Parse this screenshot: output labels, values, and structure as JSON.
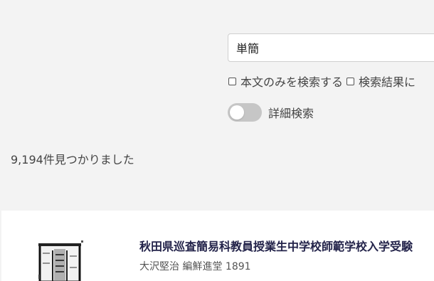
{
  "search": {
    "query": "単簡"
  },
  "options": {
    "body_only_label": "本文のみを検索する",
    "in_results_label": "検索結果に"
  },
  "advanced": {
    "toggle_label": "詳細検索",
    "enabled": false
  },
  "results": {
    "count_text": "9,194件見つかりました",
    "items": [
      {
        "title": "秋田県巡査簡易科教員授業生中学校師範学校入学受験",
        "author": "大沢堅治",
        "publisher": "編鮮進堂",
        "year": "1891",
        "checked_body_only": false
      }
    ]
  },
  "colors": {
    "background": "#f3f3f3",
    "card": "#ffffff",
    "title": "#23234a",
    "toggle_off": "#c6c6c6"
  }
}
